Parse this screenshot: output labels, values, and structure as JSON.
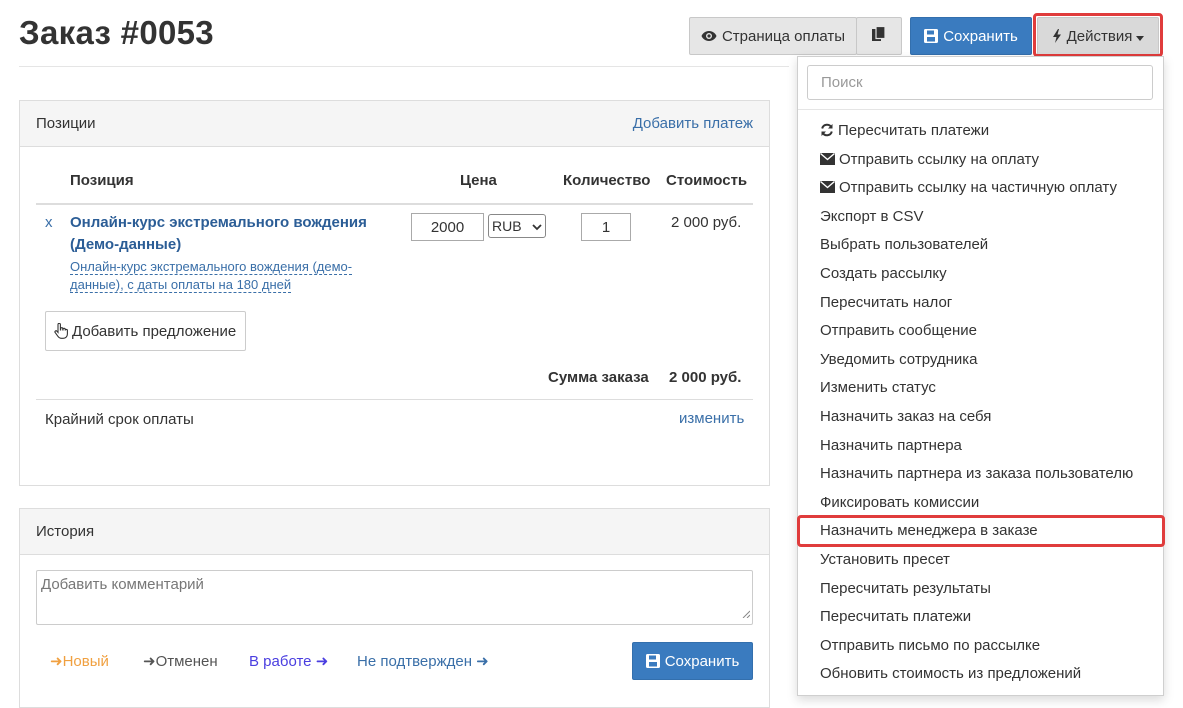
{
  "page": {
    "title": "Заказ #0053"
  },
  "toolbar": {
    "payment_page_label": "Страница оплаты",
    "save_label": "Сохранить",
    "actions_label": "Действия"
  },
  "positions_panel": {
    "title": "Позиции",
    "add_payment_link": "Добавить платеж",
    "columns": {
      "position": "Позиция",
      "price": "Цена",
      "quantity": "Количество",
      "cost": "Стоимость"
    },
    "item": {
      "remove_label": "x",
      "name_line1": "Онлайн-курс экстремального вождения",
      "name_line2": "(Демо-данные)",
      "description_line1": "Онлайн-курс экстремального вождения (демо-",
      "description_line2": "данные), с даты оплаты на 180 дней",
      "price": "2000",
      "currency": "RUB",
      "quantity": "1",
      "cost": "2 000 руб."
    },
    "add_offer_label": "Добавить предложение",
    "total_label": "Сумма заказа",
    "total_value": "2 000 руб.",
    "deadline_label": "Крайний срок оплаты",
    "deadline_change_link": "изменить"
  },
  "history_panel": {
    "title": "История",
    "comment_placeholder": "Добавить комментарий",
    "save_label": "Сохранить",
    "statuses": {
      "new": "Новый",
      "cancelled": "Отменен",
      "in_progress": "В работе",
      "unconfirmed": "Не подтвержден"
    }
  },
  "actions_menu": {
    "search_placeholder": "Поиск",
    "items": [
      {
        "label": "Пересчитать платежи",
        "icon": "refresh-icon"
      },
      {
        "label": "Отправить ссылку на оплату",
        "icon": "envelope-icon"
      },
      {
        "label": "Отправить ссылку на частичную оплату",
        "icon": "envelope-icon"
      },
      {
        "label": "Экспорт в CSV"
      },
      {
        "label": "Выбрать пользователей"
      },
      {
        "label": "Создать рассылку"
      },
      {
        "label": "Пересчитать налог"
      },
      {
        "label": "Отправить сообщение"
      },
      {
        "label": "Уведомить сотрудника"
      },
      {
        "label": "Изменить статус"
      },
      {
        "label": "Назначить заказ на себя"
      },
      {
        "label": "Назначить партнера"
      },
      {
        "label": "Назначить партнера из заказа пользователю"
      },
      {
        "label": "Фиксировать комиссии"
      },
      {
        "label": "Назначить менеджера в заказе"
      },
      {
        "label": "Установить пресет"
      },
      {
        "label": "Пересчитать результаты"
      },
      {
        "label": "Пересчитать платежи"
      },
      {
        "label": "Отправить письмо по рассылке"
      },
      {
        "label": "Обновить стоимость из предложений"
      }
    ]
  },
  "colors": {
    "primary": "#3a7bbf",
    "highlight": "#e03c3c",
    "link": "#3a6fa8",
    "status_new": "#f0a040",
    "status_in_progress": "#4a3ee0",
    "status_unconfirmed": "#3a6fa8"
  }
}
